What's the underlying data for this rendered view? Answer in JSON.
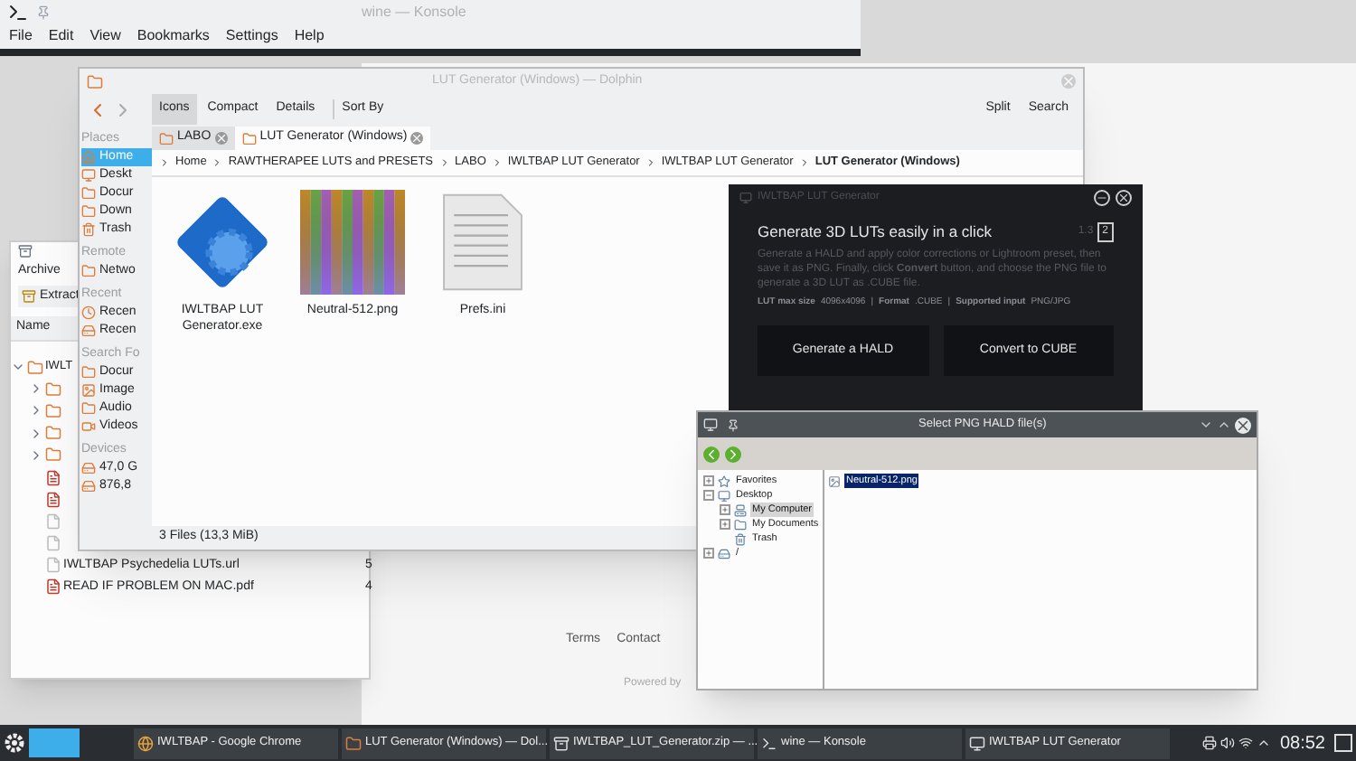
{
  "web_page": {
    "links": [
      "Terms",
      "Contact"
    ],
    "footer": "Powered by"
  },
  "konsole": {
    "title": "wine — Konsole",
    "menu": [
      "File",
      "Edit",
      "View",
      "Bookmarks",
      "Settings",
      "Help"
    ]
  },
  "ark": {
    "menu": [
      "Archive"
    ],
    "extract_button": "Extract",
    "column": "Name",
    "rows": [
      {
        "name": "IWLT",
        "kind": "folder",
        "expanded": true,
        "children": [
          {
            "kind": "folder",
            "expanded": false
          },
          {
            "kind": "folder",
            "expanded": false
          },
          {
            "kind": "folder",
            "expanded": false
          },
          {
            "kind": "folder",
            "expanded": false
          },
          {
            "kind": "pdf"
          },
          {
            "kind": "pdf"
          },
          {
            "kind": "file"
          },
          {
            "kind": "file"
          },
          {
            "name": "IWLTBAP Psychedelia LUTs.url",
            "kind": "file",
            "size": "5"
          },
          {
            "name": "READ IF PROBLEM ON MAC.pdf",
            "kind": "pdf",
            "size": "4"
          }
        ]
      }
    ]
  },
  "dolphin": {
    "title": "LUT Generator (Windows) — Dolphin",
    "view_modes": [
      {
        "label": "Icons",
        "selected": true
      },
      {
        "label": "Compact",
        "selected": false
      },
      {
        "label": "Details",
        "selected": false
      }
    ],
    "sort_by": "Sort By",
    "split": "Split",
    "search": "Search",
    "tabs": [
      {
        "label": "LABO",
        "selected": false
      },
      {
        "label": "LUT Generator (Windows)",
        "selected": true
      }
    ],
    "places": [
      {
        "heading": "Places",
        "items": [
          {
            "label": "Home",
            "kind": "home",
            "selected": true
          },
          {
            "label": "Deskt",
            "kind": "desktop",
            "selected": false
          },
          {
            "label": "Docur",
            "kind": "folder",
            "selected": false
          },
          {
            "label": "Down",
            "kind": "folder",
            "selected": false
          },
          {
            "label": "Trash",
            "kind": "trash",
            "selected": false
          }
        ]
      },
      {
        "heading": "Remote",
        "items": [
          {
            "label": "Netwo",
            "kind": "folder",
            "selected": false
          }
        ]
      },
      {
        "heading": "Recent",
        "items": [
          {
            "label": "Recen",
            "kind": "clock",
            "selected": false
          },
          {
            "label": "Recen",
            "kind": "drive",
            "selected": false
          }
        ]
      },
      {
        "heading": "Search Fo",
        "items": [
          {
            "label": "Docur",
            "kind": "folder",
            "selected": false
          },
          {
            "label": "Image",
            "kind": "image",
            "selected": false
          },
          {
            "label": "Audio",
            "kind": "folder",
            "selected": false
          },
          {
            "label": "Videos",
            "kind": "video",
            "selected": false
          }
        ]
      },
      {
        "heading": "Devices",
        "items": [
          {
            "label": "47,0 G",
            "kind": "drive",
            "selected": false
          },
          {
            "label": "876,8",
            "kind": "drive",
            "selected": false
          }
        ]
      }
    ],
    "breadcrumb": [
      "Home",
      "RAWTHERAPEE LUTS and PRESETS",
      "LABO",
      "IWLTBAP LUT Generator",
      "IWLTBAP LUT Generator",
      "LUT Generator (Windows)"
    ],
    "files": [
      {
        "name": "IWLTBAP LUT Generator.exe",
        "kind": "app"
      },
      {
        "name": "Neutral-512.png",
        "kind": "image"
      },
      {
        "name": "Prefs.ini",
        "kind": "text"
      }
    ],
    "status": "3 Files (13,3 MiB)"
  },
  "lut_generator": {
    "title": "IWLTBAP LUT Generator",
    "heading": "Generate 3D LUTs easily in a click",
    "version": "1.3",
    "page": "2",
    "description": "Generate a HALD and apply color corrections or Lightroom preset, then save it as PNG. Finally, click **Convert** button, and choose the PNG file to generate a 3D LUT as .CUBE file.",
    "info": [
      {
        "label": "LUT max size",
        "value": "4096x4096"
      },
      {
        "separator": "|",
        "label": "Format",
        "value": ".CUBE"
      },
      {
        "separator": "|",
        "label": "Supported input",
        "value": "PNG/JPG"
      }
    ],
    "buttons": [
      "Generate a HALD",
      "Convert to CUBE"
    ]
  },
  "file_dialog": {
    "title": "Select PNG HALD file(s)",
    "tree": [
      {
        "label": "Favorites",
        "kind": "star",
        "expanded": false,
        "selected": false
      },
      {
        "label": "Desktop",
        "kind": "desktop",
        "expanded": true,
        "selected": false,
        "children": [
          {
            "label": "My Computer",
            "kind": "computer",
            "expanded": false,
            "selected": true
          },
          {
            "label": "My Documents",
            "kind": "folder",
            "expanded": false,
            "selected": false
          },
          {
            "label": "Trash",
            "kind": "trash",
            "selected": false
          }
        ]
      },
      {
        "label": "/",
        "kind": "drive",
        "expanded": false,
        "selected": false
      }
    ],
    "files": [
      {
        "name": "Neutral-512.png",
        "selected": true
      }
    ]
  },
  "taskbar": {
    "tasks": [
      {
        "label": "IWLTBAP - Google Chrome",
        "kind": "browser"
      },
      {
        "label": "LUT Generator (Windows) — Dol...",
        "kind": "folder"
      },
      {
        "label": "IWLTBAP_LUT_Generator.zip — ...",
        "kind": "archive"
      },
      {
        "label": "wine — Konsole",
        "kind": "terminal"
      },
      {
        "label": "IWLTBAP LUT Generator",
        "kind": "app"
      }
    ],
    "clock": "08:52"
  }
}
